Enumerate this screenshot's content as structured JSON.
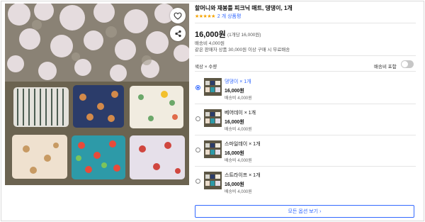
{
  "product": {
    "title": "할머니와 재봉틀 피크닉 매트, 댕댕이, 1개",
    "stars": "★★★★★",
    "review_count": "2 개 상품평",
    "price": "16,000원",
    "unit_price": "(1개당 16,000원)",
    "shipping_fee": "배송비 4,000원",
    "shipping_note": "같은 판매자 상품 30,000원 이상 구매 시 무료배송"
  },
  "image": {
    "favorite_icon": "heart-outline-icon",
    "share_icon": "share-icon"
  },
  "options": {
    "label": "색상 × 수량",
    "include_shipping_label": "배송비 포함",
    "include_shipping_on": false,
    "items": [
      {
        "name": "댕댕이 × 1개",
        "price": "16,000원",
        "shipping": "배송비 4,000원",
        "selected": true
      },
      {
        "name": "베어데이 × 1개",
        "price": "16,000원",
        "shipping": "배송비 4,000원",
        "selected": false
      },
      {
        "name": "스마일데이 × 1개",
        "price": "16,000원",
        "shipping": "배송비 4,000원",
        "selected": false
      },
      {
        "name": "스트라이프 × 1개",
        "price": "16,000원",
        "shipping": "배송비 4,000원",
        "selected": false
      }
    ],
    "view_all_label": "모든 옵션 보기 ›"
  },
  "colors": {
    "accent": "#346aff",
    "star": "#f5a300"
  }
}
